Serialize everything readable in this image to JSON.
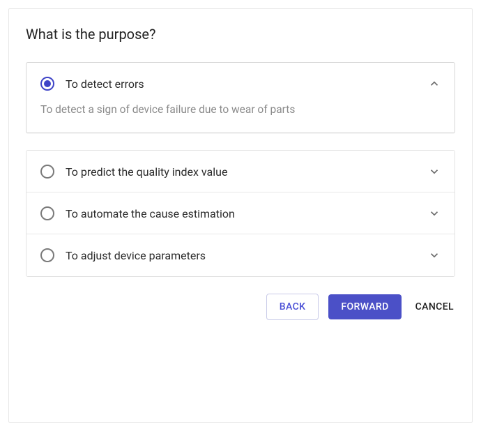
{
  "title": "What is the purpose?",
  "options": [
    {
      "label": "To detect errors",
      "description": "To detect a sign of device failure due to wear of parts",
      "selected": true,
      "expanded": true
    },
    {
      "label": "To predict the quality index value",
      "selected": false,
      "expanded": false
    },
    {
      "label": "To automate the cause estimation",
      "selected": false,
      "expanded": false
    },
    {
      "label": "To adjust device parameters",
      "selected": false,
      "expanded": false
    }
  ],
  "buttons": {
    "back": "BACK",
    "forward": "FORWARD",
    "cancel": "CANCEL"
  }
}
